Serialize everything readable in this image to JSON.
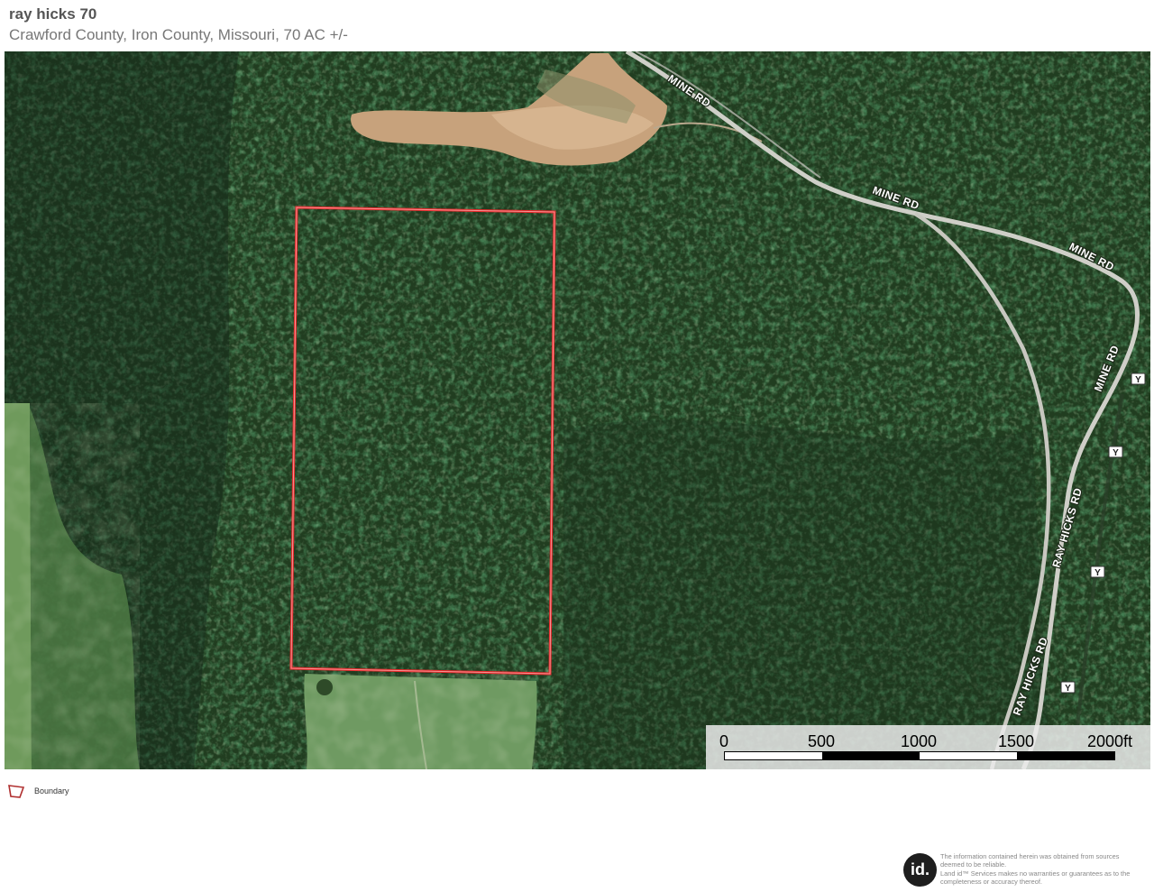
{
  "header": {
    "title": "ray hicks 70",
    "subtitle": "Crawford County, Iron County, Missouri, 70 AC +/-"
  },
  "map": {
    "type": "satellite imagery",
    "boundary_color": "#e8292b",
    "road_labels": [
      {
        "id": "mine-rd-1",
        "text": "MINE RD"
      },
      {
        "id": "mine-rd-2",
        "text": "MINE RD"
      },
      {
        "id": "mine-rd-3",
        "text": "MINE RD"
      },
      {
        "id": "mine-rd-4",
        "text": "MINE RD"
      },
      {
        "id": "ray-hicks-rd-1",
        "text": "RAY HICKS RD"
      },
      {
        "id": "ray-hicks-rd-2",
        "text": "RAY HICKS RD"
      }
    ],
    "route_shields": [
      "Y",
      "Y",
      "Y",
      "Y"
    ]
  },
  "scale": {
    "labels": [
      "0",
      "500",
      "1000",
      "1500",
      "2000ft"
    ]
  },
  "legend": {
    "items": [
      {
        "label": "Boundary",
        "icon": "boundary-polygon-icon",
        "color": "#b03030"
      }
    ]
  },
  "footer": {
    "logo_text": "id.",
    "disclaimer_lines": [
      "The information contained herein was obtained from sources",
      "deemed to be reliable.",
      "Land id™ Services makes no warranties or guarantees as to the",
      "completeness or accuracy thereof."
    ]
  }
}
